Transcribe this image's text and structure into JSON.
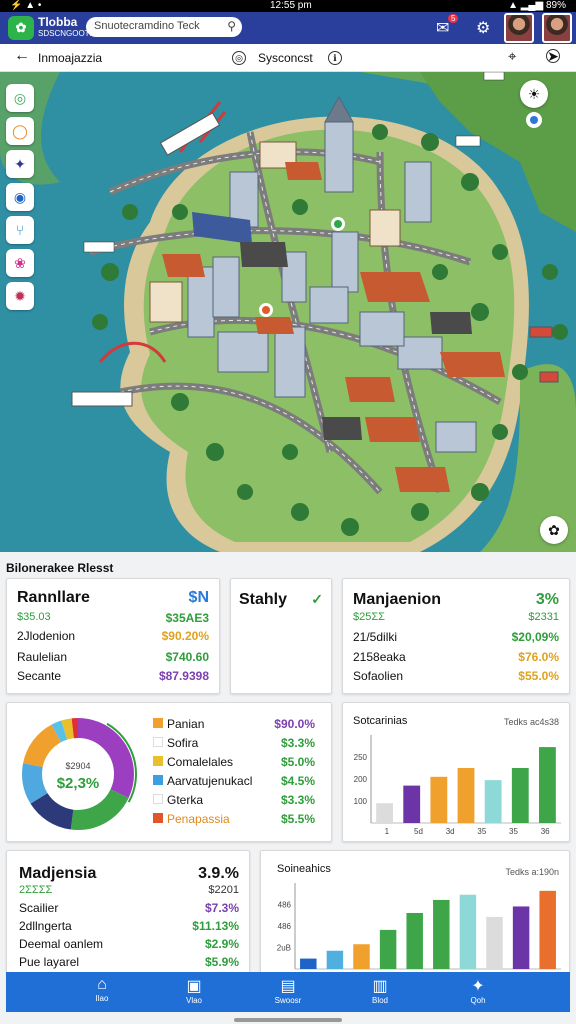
{
  "status": {
    "left": "⚡ ▲ •",
    "center": "12:55 pm",
    "right": "▲ ▂▄▆ 89%"
  },
  "app": {
    "brand": "Tlobba",
    "tagline": "SDSCNGOOTN",
    "search_placeholder": "Snuotecramdino Teck",
    "badge": "5"
  },
  "subbar": {
    "back": "←",
    "title": "Inmoajazzia",
    "compass": "◎",
    "location": "Sysconcst",
    "info": "ℹ"
  },
  "map_tools": [
    {
      "name": "layers-tool",
      "glyph": "◎",
      "color": "#3aa85a"
    },
    {
      "name": "pin-tool",
      "glyph": "◯",
      "color": "#e8851c"
    },
    {
      "name": "route-tool",
      "glyph": "✦",
      "color": "#2b3a8c"
    },
    {
      "name": "transit-tool",
      "glyph": "◉",
      "color": "#1e63c8"
    },
    {
      "name": "filter-tool",
      "glyph": "⑂",
      "color": "#1e8fd0"
    },
    {
      "name": "poi-tool",
      "glyph": "❀",
      "color": "#cf2f8a"
    },
    {
      "name": "traffic-tool",
      "glyph": "✹",
      "color": "#c2305a"
    }
  ],
  "section_title": "Bilonerakee Rlesst",
  "card1": {
    "title": "Rannllare",
    "badge": "$N",
    "rows": [
      {
        "label": "$35.03",
        "value": "$35ΑΕ3",
        "color": "#2e9e3a"
      },
      {
        "label": "2Jlodenion",
        "value": "$90.20%",
        "color": "#e0a21c"
      },
      {
        "label": "Raulelian",
        "value": "$740.60",
        "color": "#2e9e3a"
      },
      {
        "label": "Secante",
        "value": "$87.9398",
        "color": "#7b3fb0"
      }
    ]
  },
  "card2": {
    "title": "Stahly",
    "check": "✓"
  },
  "card3": {
    "title": "Manjaenion",
    "badge": "3%",
    "rows": [
      {
        "label": "$25ΣΣ",
        "value": "$2331",
        "color": "#2e9e3a"
      },
      {
        "label": "21/5dilki",
        "value": "$20,09%",
        "color": "#2e9e3a"
      },
      {
        "label": "2158eaka",
        "value": "$76.0%",
        "color": "#e0a21c"
      },
      {
        "label": "Sofaolien",
        "value": "$55.0%",
        "color": "#e0a21c"
      }
    ]
  },
  "donut": {
    "center_top": "$2904",
    "center_value": "$2,3%",
    "slices": [
      {
        "value": 32,
        "color": "#9b3fc0"
      },
      {
        "value": 20,
        "color": "#3ea649"
      },
      {
        "value": 14,
        "color": "#2d3a7a"
      },
      {
        "value": 12,
        "color": "#4fa8e0"
      },
      {
        "value": 14,
        "color": "#f0a02c"
      },
      {
        "value": 3,
        "color": "#5bc0e8"
      },
      {
        "value": 3,
        "color": "#e8c02c"
      },
      {
        "value": 2,
        "color": "#e03030"
      }
    ],
    "legend": [
      {
        "label": "Panian",
        "value": "$90.0%",
        "color": "#f0a02c",
        "vcolor": "#7b3fb0"
      },
      {
        "label": "Sofira",
        "value": "$3.3%",
        "color": "#ffffff",
        "vcolor": "#2e9e3a"
      },
      {
        "label": "Comalelales",
        "value": "$5.0%",
        "color": "#e8c02c",
        "vcolor": "#2e9e3a"
      },
      {
        "label": "Aarvatujenukacl",
        "value": "$4.5%",
        "color": "#3aa0e0",
        "vcolor": "#2e9e3a"
      },
      {
        "label": "Gterka",
        "value": "$3.3%",
        "color": "#ffffff",
        "vcolor": "#2e9e3a"
      },
      {
        "label": "Penapassia",
        "value": "$5.5%",
        "color": "#e0552a",
        "vcolor": "#2e9e3a",
        "lcolor": "#e08a1c"
      }
    ]
  },
  "chart_data": [
    {
      "type": "bar",
      "title": "Sotcarinias",
      "note": "Tedks ac4s38",
      "categories": [
        "1",
        "5d",
        "3d",
        "35",
        "35",
        "36"
      ],
      "values": [
        90,
        170,
        210,
        250,
        195,
        250,
        345
      ],
      "colors": [
        "#dcdcdc",
        "#6b35a8",
        "#f0a02c",
        "#f0a02c",
        "#8ed8d8",
        "#3ea649",
        "#3ea649"
      ],
      "yticks": [
        "100",
        "200",
        "250"
      ],
      "ylim": [
        0,
        400
      ]
    },
    {
      "type": "bar",
      "title": "Soineahics",
      "note": "Tedks a:190n",
      "categories": [],
      "values": [
        40,
        70,
        95,
        150,
        215,
        265,
        285,
        200,
        240,
        300
      ],
      "colors": [
        "#1e63c8",
        "#4fb0e0",
        "#f0a02c",
        "#3ea649",
        "#3ea649",
        "#3ea649",
        "#8ed8d8",
        "#dcdcdc",
        "#6b35a8",
        "#e8702c"
      ],
      "yticks": [
        "2uB",
        "486",
        "486"
      ],
      "ylim": [
        0,
        330
      ]
    }
  ],
  "card6": {
    "title": "Madjensia",
    "badge": "3.9.%",
    "rows": [
      {
        "label": "2ΣΣΣΣ",
        "value": "$2201",
        "color": "#2e9e3a"
      },
      {
        "label": "Scailier",
        "value": "$7.3%",
        "color": "#7b3fb0"
      },
      {
        "label": "2dllngerta",
        "value": "$11.13%",
        "color": "#2e9e3a"
      },
      {
        "label": "Deemal oanlem",
        "value": "$2.9%",
        "color": "#2e9e3a"
      },
      {
        "label": "Pue layarel",
        "value": "$5.9%",
        "color": "#2e9e3a"
      }
    ]
  },
  "nav": [
    {
      "label": "Ilao",
      "glyph": "⌂"
    },
    {
      "label": "Vlao",
      "glyph": "▣"
    },
    {
      "label": "Swoosr",
      "glyph": "▤"
    },
    {
      "label": "Blod",
      "glyph": "▥"
    },
    {
      "label": "Qoh",
      "glyph": "✦"
    }
  ]
}
